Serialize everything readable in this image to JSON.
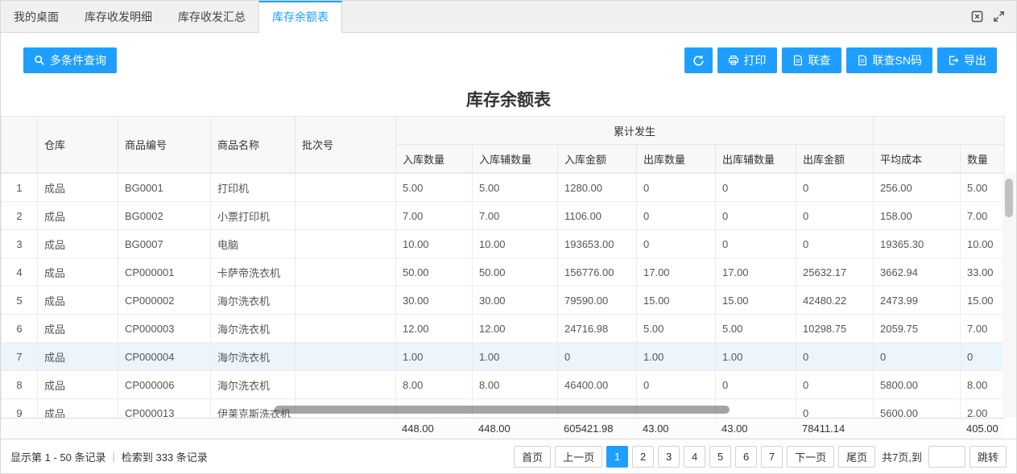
{
  "colors": {
    "accent": "#1E9FFF",
    "row_highlight": "#ecf5fc"
  },
  "tab_bar": {
    "tabs": [
      {
        "label": "我的桌面",
        "active": false
      },
      {
        "label": "库存收发明细",
        "active": false
      },
      {
        "label": "库存收发汇总",
        "active": false
      },
      {
        "label": "库存余额表",
        "active": true
      }
    ]
  },
  "toolbar": {
    "query_label": "多条件查询",
    "print_label": "打印",
    "linked_query_label": "联查",
    "linked_query_sn_label": "联查SN码",
    "export_label": "导出"
  },
  "report": {
    "title": "库存余额表"
  },
  "table": {
    "group_label": "累计发生",
    "leading_columns": [
      "仓库",
      "商品编号",
      "商品名称",
      "批次号"
    ],
    "group_columns": [
      "入库数量",
      "入库辅数量",
      "入库金额",
      "出库数量",
      "出库辅数量",
      "出库金额"
    ],
    "trailing_columns": [
      "平均成本",
      "数量"
    ],
    "selected_row_number": "7",
    "rows": [
      [
        "1",
        "成品",
        "BG0001",
        "打印机",
        "",
        "5.00",
        "5.00",
        "1280.00",
        "0",
        "0",
        "0",
        "256.00",
        "5.00"
      ],
      [
        "2",
        "成品",
        "BG0002",
        "小票打印机",
        "",
        "7.00",
        "7.00",
        "1106.00",
        "0",
        "0",
        "0",
        "158.00",
        "7.00"
      ],
      [
        "3",
        "成品",
        "BG0007",
        "电脑",
        "",
        "10.00",
        "10.00",
        "193653.00",
        "0",
        "0",
        "0",
        "19365.30",
        "10.00"
      ],
      [
        "4",
        "成品",
        "CP000001",
        "卡萨帝洗衣机",
        "",
        "50.00",
        "50.00",
        "156776.00",
        "17.00",
        "17.00",
        "25632.17",
        "3662.94",
        "33.00"
      ],
      [
        "5",
        "成品",
        "CP000002",
        "海尔洗衣机",
        "",
        "30.00",
        "30.00",
        "79590.00",
        "15.00",
        "15.00",
        "42480.22",
        "2473.99",
        "15.00"
      ],
      [
        "6",
        "成品",
        "CP000003",
        "海尔洗衣机",
        "",
        "12.00",
        "12.00",
        "24716.98",
        "5.00",
        "5.00",
        "10298.75",
        "2059.75",
        "7.00"
      ],
      [
        "7",
        "成品",
        "CP000004",
        "海尔洗衣机",
        "",
        "1.00",
        "1.00",
        "0",
        "1.00",
        "1.00",
        "0",
        "0",
        "0"
      ],
      [
        "8",
        "成品",
        "CP000006",
        "海尔洗衣机",
        "",
        "8.00",
        "8.00",
        "46400.00",
        "0",
        "0",
        "0",
        "5800.00",
        "8.00"
      ],
      [
        "9",
        "成品",
        "CP000013",
        "伊莱克斯洗衣机",
        "",
        "",
        "",
        "",
        "",
        "",
        "0",
        "5600.00",
        "2.00"
      ]
    ],
    "summary": [
      "",
      "",
      "",
      "",
      "",
      "448.00",
      "448.00",
      "605421.98",
      "43.00",
      "43.00",
      "78411.14",
      "",
      "405.00"
    ]
  },
  "footer": {
    "status_left": "显示第 1 - 50 条记录",
    "status_divider": "|",
    "status_right": "检索到 333 条记录",
    "pagination": {
      "first": "首页",
      "prev": "上一页",
      "pages": [
        "1",
        "2",
        "3",
        "4",
        "5",
        "6",
        "7"
      ],
      "active_page": "1",
      "next": "下一页",
      "last": "尾页",
      "total_text": "共7页,到",
      "jump_value": "",
      "jump_label": "跳转"
    }
  }
}
